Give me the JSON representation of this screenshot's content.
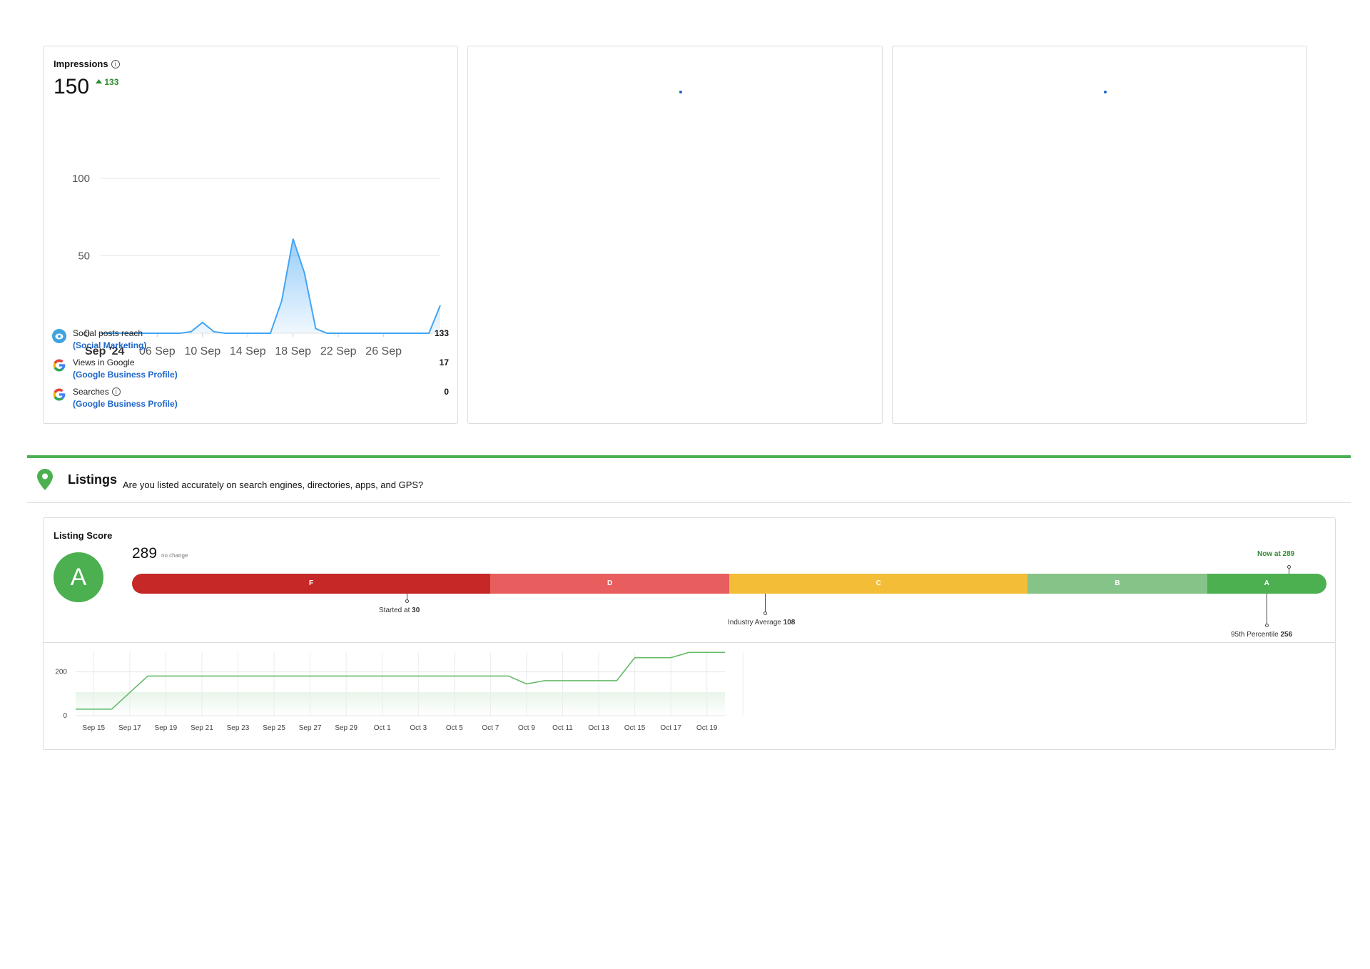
{
  "impressions": {
    "title": "Impressions",
    "info_glyph": "i",
    "value": "150",
    "delta": "133",
    "delta_color": "#2e8b30",
    "legend": [
      {
        "label": "Social posts reach",
        "source": "(Social Marketing)",
        "value": "133",
        "icon": "social-marketing-icon",
        "has_info": false
      },
      {
        "label": "Views in Google",
        "source": "(Google Business Profile)",
        "value": "17",
        "icon": "google-icon",
        "has_info": false
      },
      {
        "label": "Searches",
        "source": "(Google Business Profile)",
        "value": "0",
        "icon": "google-icon",
        "has_info": true
      }
    ],
    "link_color": "#1e66c8"
  },
  "chart_data": [
    {
      "type": "area",
      "title": "",
      "xlabel": "",
      "ylabel": "",
      "ylim": [
        0,
        100
      ],
      "y_ticks": [
        0,
        50,
        100
      ],
      "x_tick_labels": [
        "Sep '24",
        "06 Sep",
        "10 Sep",
        "14 Sep",
        "18 Sep",
        "22 Sep",
        "26 Sep"
      ],
      "x_tick_days": [
        1,
        6,
        10,
        14,
        18,
        22,
        26
      ],
      "grid": true,
      "color": "#42a5f5",
      "series": [
        {
          "days": [
            1,
            2,
            3,
            4,
            5,
            6,
            7,
            8,
            9,
            10,
            11,
            12,
            13,
            14,
            15,
            16,
            17,
            18,
            19,
            20,
            21,
            22,
            23,
            24,
            25,
            26,
            27,
            28,
            29,
            30,
            31
          ],
          "values": [
            0,
            0,
            0,
            0,
            0,
            0,
            0,
            0,
            1,
            7,
            1,
            0,
            0,
            0,
            0,
            0,
            21,
            61,
            39,
            3,
            0,
            0,
            0,
            0,
            0,
            0,
            0,
            0,
            0,
            0,
            18
          ]
        }
      ]
    },
    {
      "type": "line",
      "title": "",
      "xlabel": "",
      "ylabel": "",
      "ylim": [
        0,
        290
      ],
      "y_ticks": [
        0,
        200
      ],
      "x_tick_labels": [
        "Sep 15",
        "Sep 17",
        "Sep 19",
        "Sep 21",
        "Sep 23",
        "Sep 25",
        "Sep 27",
        "Sep 29",
        "Oct 1",
        "Oct 3",
        "Oct 5",
        "Oct 7",
        "Oct 9",
        "Oct 11",
        "Oct 13",
        "Oct 15",
        "Oct 17",
        "Oct 19"
      ],
      "grid": true,
      "color": "#66bb6a",
      "x_range": [
        0,
        36
      ],
      "series": [
        {
          "x": [
            0,
            2,
            4,
            24,
            25,
            26,
            28,
            30,
            31,
            32,
            33,
            34,
            36
          ],
          "values": [
            30,
            30,
            181,
            181,
            145,
            160,
            160,
            160,
            265,
            265,
            265,
            289,
            289
          ]
        }
      ]
    }
  ],
  "listings": {
    "title": "Listings",
    "subtitle": "Are you listed accurately on search engines, directories, apps, and GPS?",
    "accent_color": "#4caf50",
    "score_label": "Listing Score",
    "grade": "A",
    "score": "289",
    "score_change": "no change",
    "grade_segments": [
      {
        "label": "F",
        "fraction": 0.3,
        "color": "#c62828"
      },
      {
        "label": "D",
        "fraction": 0.2,
        "color": "#e85d5d"
      },
      {
        "label": "C",
        "fraction": 0.25,
        "color": "#f4bd38"
      },
      {
        "label": "B",
        "fraction": 0.15,
        "color": "#86c388"
      },
      {
        "label": "A",
        "fraction": 0.1,
        "color": "#4caf50"
      }
    ],
    "markers": {
      "started_prefix": "Started at ",
      "started_value": "30",
      "industry_prefix": "Industry Average ",
      "industry_value": "108",
      "percentile_prefix": "95th Percentile ",
      "percentile_value": "256",
      "now_label": "Now at 289"
    }
  }
}
